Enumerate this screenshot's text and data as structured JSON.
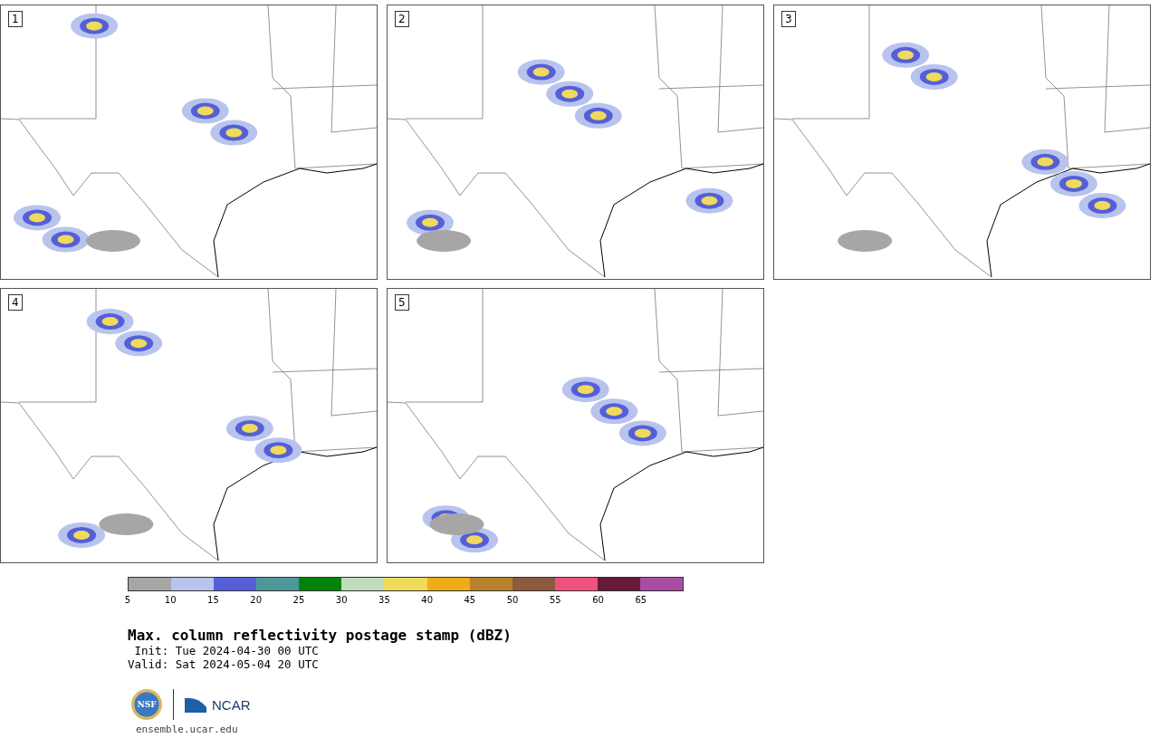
{
  "panels": [
    {
      "label": "1"
    },
    {
      "label": "2"
    },
    {
      "label": "3"
    },
    {
      "label": "4"
    },
    {
      "label": "5"
    }
  ],
  "colorbar": {
    "segments": [
      {
        "color": "#a6a6a6"
      },
      {
        "color": "#b8c3ee"
      },
      {
        "color": "#545fd8"
      },
      {
        "color": "#4f9899"
      },
      {
        "color": "#03830a"
      },
      {
        "color": "#bfdcbd"
      },
      {
        "color": "#efda5c"
      },
      {
        "color": "#eeac16"
      },
      {
        "color": "#b8822d"
      },
      {
        "color": "#8b5a3f"
      },
      {
        "color": "#f1527b"
      },
      {
        "color": "#661938"
      },
      {
        "color": "#a94ca2"
      }
    ],
    "ticks": [
      "5",
      "10",
      "15",
      "20",
      "25",
      "30",
      "35",
      "40",
      "45",
      "50",
      "55",
      "60",
      "65"
    ]
  },
  "title": "Max. column reflectivity postage stamp (dBZ)",
  "init": " Init: Tue 2024-04-30 00 UTC",
  "valid": "Valid: Sat 2024-05-04 20 UTC",
  "logos": {
    "nsf": "NSF",
    "ncar": "NCAR"
  },
  "footer": "ensemble.ucar.edu"
}
